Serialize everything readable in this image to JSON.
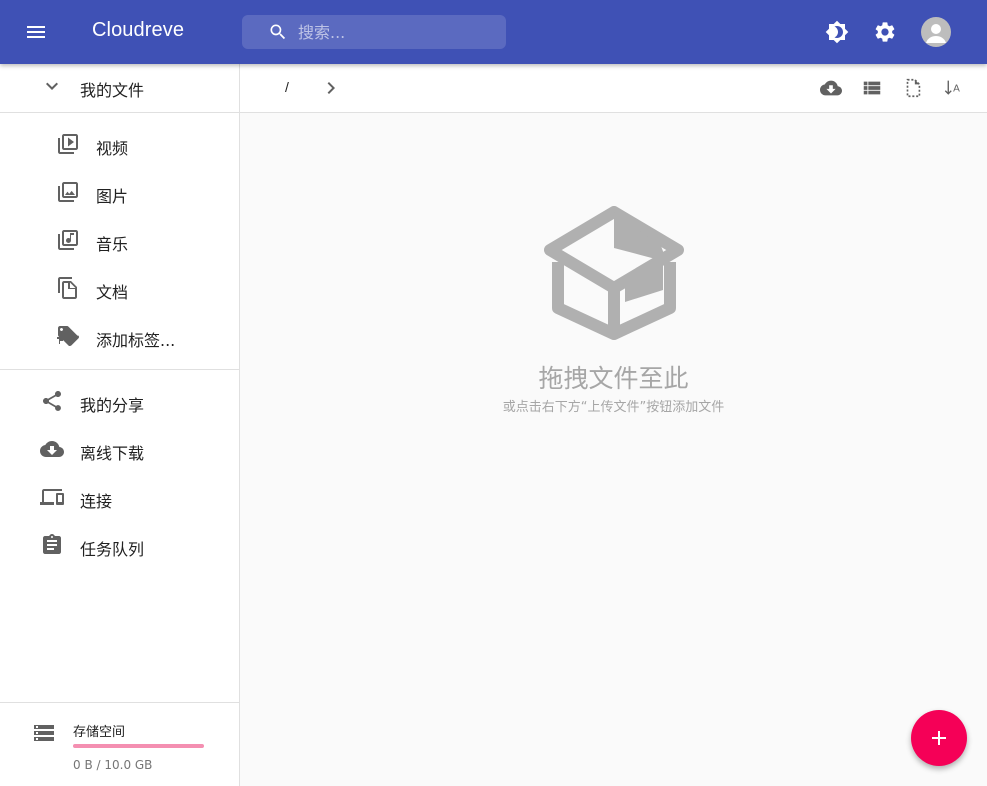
{
  "app": {
    "title": "Cloudreve"
  },
  "search": {
    "placeholder": "搜索..."
  },
  "topbar_icons": [
    "menu-icon",
    "brightness-icon",
    "settings-icon",
    "account-icon"
  ],
  "sidebar": {
    "my_files": {
      "label": "我的文件",
      "icon": "chevron-down-icon"
    },
    "categories": [
      {
        "label": "视频",
        "icon": "video-library-icon"
      },
      {
        "label": "图片",
        "icon": "photo-library-icon"
      },
      {
        "label": "音乐",
        "icon": "library-music-icon"
      },
      {
        "label": "文档",
        "icon": "file-copy-icon"
      },
      {
        "label": "添加标签...",
        "icon": "add-tag-icon"
      }
    ],
    "main_items": [
      {
        "label": "我的分享",
        "icon": "share-icon"
      },
      {
        "label": "离线下载",
        "icon": "cloud-download-icon"
      },
      {
        "label": "连接",
        "icon": "devices-icon"
      },
      {
        "label": "任务队列",
        "icon": "assignment-icon"
      }
    ],
    "storage": {
      "title": "存储空间",
      "usage": "0 B / 10.0 GB",
      "used_fraction": 0
    }
  },
  "breadcrumb": {
    "root": "/"
  },
  "toolbar_icons": [
    "cloud-download-icon",
    "view-list-icon",
    "file-select-icon",
    "sort-icon"
  ],
  "empty_state": {
    "title": "拖拽文件至此",
    "subtitle": "或点击右下方“上传文件”按钮添加文件"
  },
  "colors": {
    "primary": "#3f51b5",
    "accent": "#f50057",
    "storage_bar": "#f48fb1",
    "icon_grey": "#616161",
    "empty_grey": "#b0b0b0"
  }
}
